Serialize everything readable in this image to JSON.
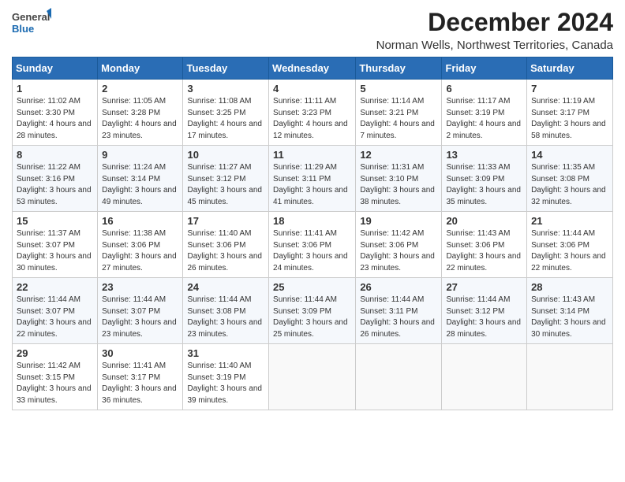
{
  "logo": {
    "text_general": "General",
    "text_blue": "Blue"
  },
  "header": {
    "month_year": "December 2024",
    "location": "Norman Wells, Northwest Territories, Canada"
  },
  "days_of_week": [
    "Sunday",
    "Monday",
    "Tuesday",
    "Wednesday",
    "Thursday",
    "Friday",
    "Saturday"
  ],
  "weeks": [
    [
      {
        "day": "1",
        "sunrise": "11:02 AM",
        "sunset": "3:30 PM",
        "daylight": "4 hours and 28 minutes."
      },
      {
        "day": "2",
        "sunrise": "11:05 AM",
        "sunset": "3:28 PM",
        "daylight": "4 hours and 23 minutes."
      },
      {
        "day": "3",
        "sunrise": "11:08 AM",
        "sunset": "3:25 PM",
        "daylight": "4 hours and 17 minutes."
      },
      {
        "day": "4",
        "sunrise": "11:11 AM",
        "sunset": "3:23 PM",
        "daylight": "4 hours and 12 minutes."
      },
      {
        "day": "5",
        "sunrise": "11:14 AM",
        "sunset": "3:21 PM",
        "daylight": "4 hours and 7 minutes."
      },
      {
        "day": "6",
        "sunrise": "11:17 AM",
        "sunset": "3:19 PM",
        "daylight": "4 hours and 2 minutes."
      },
      {
        "day": "7",
        "sunrise": "11:19 AM",
        "sunset": "3:17 PM",
        "daylight": "3 hours and 58 minutes."
      }
    ],
    [
      {
        "day": "8",
        "sunrise": "11:22 AM",
        "sunset": "3:16 PM",
        "daylight": "3 hours and 53 minutes."
      },
      {
        "day": "9",
        "sunrise": "11:24 AM",
        "sunset": "3:14 PM",
        "daylight": "3 hours and 49 minutes."
      },
      {
        "day": "10",
        "sunrise": "11:27 AM",
        "sunset": "3:12 PM",
        "daylight": "3 hours and 45 minutes."
      },
      {
        "day": "11",
        "sunrise": "11:29 AM",
        "sunset": "3:11 PM",
        "daylight": "3 hours and 41 minutes."
      },
      {
        "day": "12",
        "sunrise": "11:31 AM",
        "sunset": "3:10 PM",
        "daylight": "3 hours and 38 minutes."
      },
      {
        "day": "13",
        "sunrise": "11:33 AM",
        "sunset": "3:09 PM",
        "daylight": "3 hours and 35 minutes."
      },
      {
        "day": "14",
        "sunrise": "11:35 AM",
        "sunset": "3:08 PM",
        "daylight": "3 hours and 32 minutes."
      }
    ],
    [
      {
        "day": "15",
        "sunrise": "11:37 AM",
        "sunset": "3:07 PM",
        "daylight": "3 hours and 30 minutes."
      },
      {
        "day": "16",
        "sunrise": "11:38 AM",
        "sunset": "3:06 PM",
        "daylight": "3 hours and 27 minutes."
      },
      {
        "day": "17",
        "sunrise": "11:40 AM",
        "sunset": "3:06 PM",
        "daylight": "3 hours and 26 minutes."
      },
      {
        "day": "18",
        "sunrise": "11:41 AM",
        "sunset": "3:06 PM",
        "daylight": "3 hours and 24 minutes."
      },
      {
        "day": "19",
        "sunrise": "11:42 AM",
        "sunset": "3:06 PM",
        "daylight": "3 hours and 23 minutes."
      },
      {
        "day": "20",
        "sunrise": "11:43 AM",
        "sunset": "3:06 PM",
        "daylight": "3 hours and 22 minutes."
      },
      {
        "day": "21",
        "sunrise": "11:44 AM",
        "sunset": "3:06 PM",
        "daylight": "3 hours and 22 minutes."
      }
    ],
    [
      {
        "day": "22",
        "sunrise": "11:44 AM",
        "sunset": "3:07 PM",
        "daylight": "3 hours and 22 minutes."
      },
      {
        "day": "23",
        "sunrise": "11:44 AM",
        "sunset": "3:07 PM",
        "daylight": "3 hours and 23 minutes."
      },
      {
        "day": "24",
        "sunrise": "11:44 AM",
        "sunset": "3:08 PM",
        "daylight": "3 hours and 23 minutes."
      },
      {
        "day": "25",
        "sunrise": "11:44 AM",
        "sunset": "3:09 PM",
        "daylight": "3 hours and 25 minutes."
      },
      {
        "day": "26",
        "sunrise": "11:44 AM",
        "sunset": "3:11 PM",
        "daylight": "3 hours and 26 minutes."
      },
      {
        "day": "27",
        "sunrise": "11:44 AM",
        "sunset": "3:12 PM",
        "daylight": "3 hours and 28 minutes."
      },
      {
        "day": "28",
        "sunrise": "11:43 AM",
        "sunset": "3:14 PM",
        "daylight": "3 hours and 30 minutes."
      }
    ],
    [
      {
        "day": "29",
        "sunrise": "11:42 AM",
        "sunset": "3:15 PM",
        "daylight": "3 hours and 33 minutes."
      },
      {
        "day": "30",
        "sunrise": "11:41 AM",
        "sunset": "3:17 PM",
        "daylight": "3 hours and 36 minutes."
      },
      {
        "day": "31",
        "sunrise": "11:40 AM",
        "sunset": "3:19 PM",
        "daylight": "3 hours and 39 minutes."
      },
      null,
      null,
      null,
      null
    ]
  ]
}
